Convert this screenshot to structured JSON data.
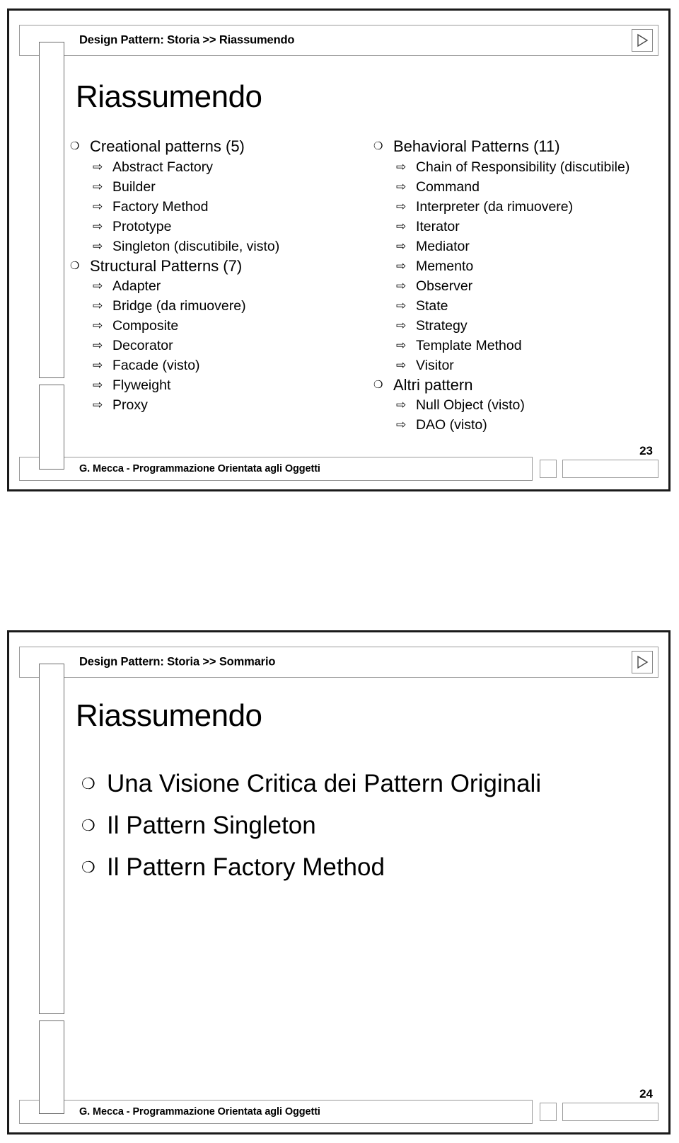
{
  "slides": [
    {
      "header": "Design Pattern: Storia >> Riassumendo",
      "nav_icon": "play-triangle-icon",
      "title": "Riassumendo",
      "left_column": [
        {
          "label": "Creational patterns (5)",
          "children": [
            "Abstract Factory",
            "Builder",
            "Factory Method",
            "Prototype",
            "Singleton (discutibile, visto)"
          ]
        },
        {
          "label": "Structural Patterns (7)",
          "children": [
            "Adapter",
            "Bridge (da rimuovere)",
            "Composite",
            "Decorator",
            "Facade (visto)",
            "Flyweight",
            "Proxy"
          ]
        }
      ],
      "right_column": [
        {
          "label": "Behavioral Patterns (11)",
          "children": [
            "Chain of Responsibility (discutibile)",
            "Command",
            "Interpreter (da rimuovere)",
            "Iterator",
            "Mediator",
            "Memento",
            "Observer",
            "State",
            "Strategy",
            "Template Method",
            "Visitor"
          ]
        },
        {
          "label": "Altri pattern",
          "children": [
            "Null Object (visto)",
            "DAO (visto)"
          ]
        }
      ],
      "footer_text": "G. Mecca - Programmazione Orientata agli Oggetti",
      "page_number": "23"
    },
    {
      "header": "Design Pattern: Storia >> Sommario",
      "nav_icon": "play-triangle-icon",
      "title": "Riassumendo",
      "items": [
        "Una Visione Critica dei Pattern Originali",
        "Il Pattern Singleton",
        "Il Pattern Factory Method"
      ],
      "footer_text": "G. Mecca - Programmazione Orientata agli Oggetti",
      "page_number": "24"
    }
  ],
  "glyphs": {
    "level1_bullet": "❍",
    "level2_bullet": "⇨"
  },
  "colors": {
    "text": "#000000",
    "frame_border": "#1a1a1a",
    "panel_border": "#9a9a9a",
    "background": "#ffffff"
  }
}
